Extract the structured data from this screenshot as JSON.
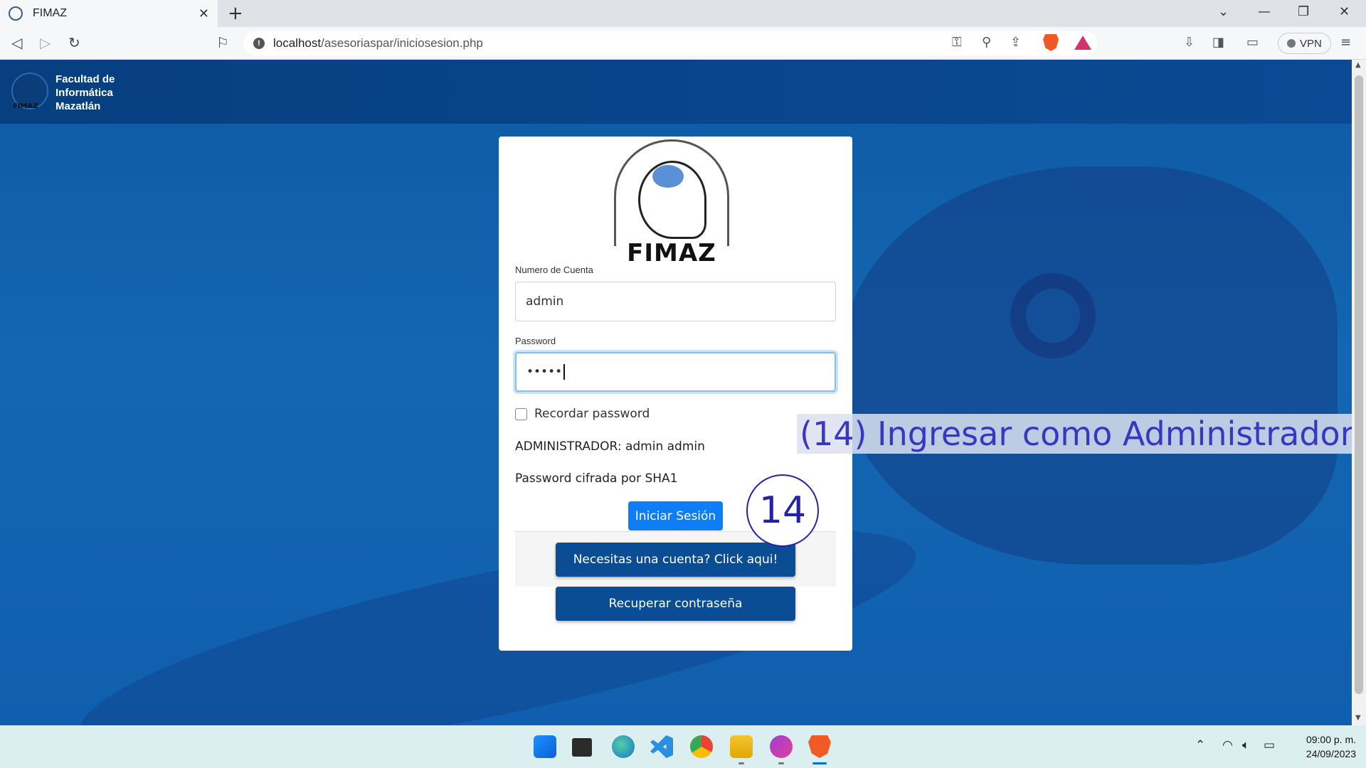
{
  "browser": {
    "tab_title": "FIMAZ",
    "tab_close": "✕",
    "new_tab": "+",
    "url_host": "localhost",
    "url_path": "/asesoriaspar/iniciosesion.php",
    "vpn_label": "VPN",
    "window_controls": {
      "minimize": "—",
      "restore": "❐",
      "close": "✕",
      "tab_list": "⌄"
    },
    "icons": [
      "back-icon",
      "forward-icon",
      "reload-icon",
      "bookmark-icon",
      "key-icon",
      "zoom-icon",
      "share-icon",
      "brave-shields-icon",
      "brave-rewards-icon",
      "download-icon",
      "sidebar-icon",
      "wallet-icon",
      "menu-icon"
    ]
  },
  "header": {
    "logo_text": "FIMAZ",
    "title_lines": [
      "Facultad de",
      "Informática",
      "Mazatlán"
    ]
  },
  "login": {
    "logo_wordmark": "FIMAZ",
    "account_label": "Numero de Cuenta",
    "account_value": "admin",
    "password_label": "Password",
    "password_value": "•••••",
    "remember_label": "Recordar password",
    "admin_note": "ADMINISTRADOR: admin admin",
    "hash_note": "Password cifrada por SHA1",
    "submit_label": "Iniciar Sesión",
    "register_label": "Necesitas una cuenta? Click aqui!",
    "recover_label": "Recuperar contraseña"
  },
  "annotation": {
    "step_number": "14",
    "step_text": "(14) Ingresar como Administrador"
  },
  "taskbar": {
    "apps": [
      "windows-start-icon",
      "task-view-icon",
      "edge-icon",
      "vscode-icon",
      "chrome-icon",
      "file-explorer-icon",
      "wps-icon",
      "brave-icon"
    ],
    "time": "09:00 p. m.",
    "date": "24/09/2023"
  },
  "colors": {
    "primary_button": "#0d7ef8",
    "dark_button": "#0b4d95",
    "page_background": "#1466b2",
    "annotation": "#3a36c4"
  }
}
